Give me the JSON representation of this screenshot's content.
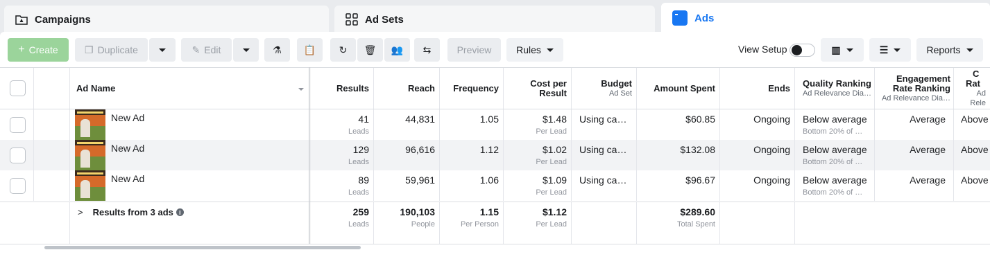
{
  "tabs": [
    {
      "label": "Campaigns",
      "icon": "campaign-icon"
    },
    {
      "label": "Ad Sets",
      "icon": "grid-icon"
    },
    {
      "label": "Ads",
      "icon": "ad-icon",
      "active": true
    }
  ],
  "toolbar": {
    "create": "Create",
    "duplicate": "Duplicate",
    "edit": "Edit",
    "preview": "Preview",
    "rules": "Rules",
    "view_setup": "View Setup",
    "reports": "Reports"
  },
  "columns": {
    "ad_name": "Ad Name",
    "results": "Results",
    "reach": "Reach",
    "frequency": "Frequency",
    "cost_per_result_1": "Cost per",
    "cost_per_result_2": "Result",
    "budget": "Budget",
    "budget_sub": "Ad Set",
    "amount_spent": "Amount Spent",
    "ends": "Ends",
    "quality": "Quality Ranking",
    "quality_sub": "Ad Relevance Dia…",
    "engagement_1": "Engagement",
    "engagement_2": "Rate Ranking",
    "engagement_sub": "Ad Relevance Dia…",
    "conversion_1": "C",
    "conversion_2": "Rat",
    "conversion_sub": "Ad Rele"
  },
  "rows": [
    {
      "name": "New Ad",
      "results": "41",
      "results_sub": "Leads",
      "reach": "44,831",
      "frequency": "1.05",
      "cpr": "$1.48",
      "cpr_sub": "Per Lead",
      "budget": "Using ca…",
      "spent": "$60.85",
      "ends": "Ongoing",
      "quality": "Below average",
      "quality_sub": "Bottom 20% of …",
      "engagement": "Average",
      "conversion": "Above"
    },
    {
      "name": "New Ad",
      "results": "129",
      "results_sub": "Leads",
      "reach": "96,616",
      "frequency": "1.12",
      "cpr": "$1.02",
      "cpr_sub": "Per Lead",
      "budget": "Using ca…",
      "spent": "$132.08",
      "ends": "Ongoing",
      "quality": "Below average",
      "quality_sub": "Bottom 20% of …",
      "engagement": "Average",
      "conversion": "Above"
    },
    {
      "name": "New Ad",
      "results": "89",
      "results_sub": "Leads",
      "reach": "59,961",
      "frequency": "1.06",
      "cpr": "$1.09",
      "cpr_sub": "Per Lead",
      "budget": "Using ca…",
      "spent": "$96.67",
      "ends": "Ongoing",
      "quality": "Below average",
      "quality_sub": "Bottom 20% of …",
      "engagement": "Average",
      "conversion": "Above"
    }
  ],
  "totals": {
    "label": "Results from 3 ads",
    "results": "259",
    "results_sub": "Leads",
    "reach": "190,103",
    "reach_sub": "People",
    "frequency": "1.15",
    "frequency_sub": "Per Person",
    "cpr": "$1.12",
    "cpr_sub": "Per Lead",
    "spent": "$289.60",
    "spent_sub": "Total Spent"
  }
}
